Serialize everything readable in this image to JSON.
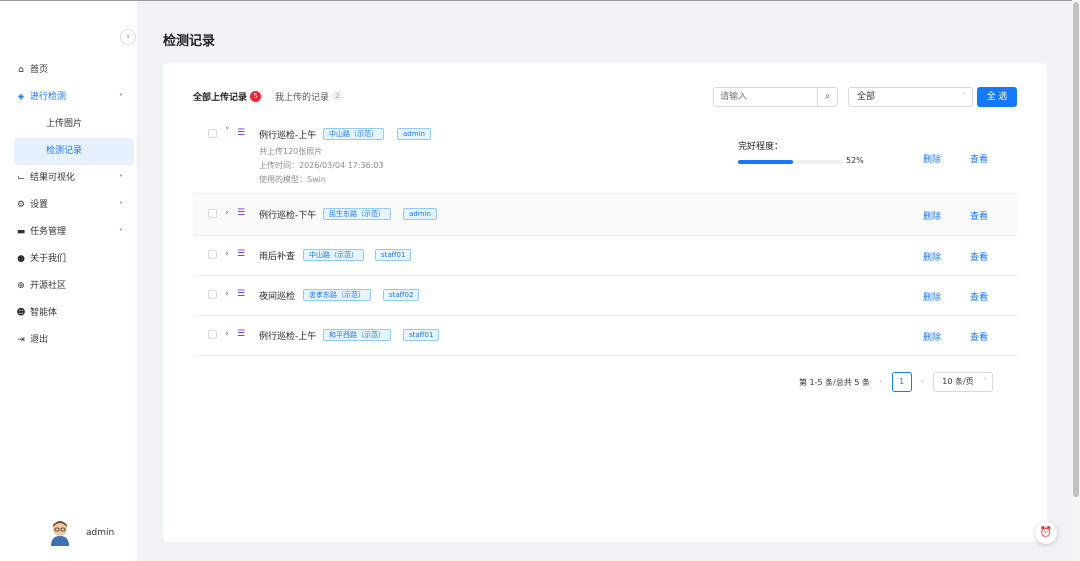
{
  "sidebar": {
    "collapse_icon": "chevron-left-icon",
    "items": [
      {
        "label": "首页",
        "icon": "home-icon"
      },
      {
        "label": "进行检测",
        "icon": "cube-icon",
        "expanded": true
      },
      {
        "label": "结果可视化",
        "icon": "line-chart-icon"
      },
      {
        "label": "设置",
        "icon": "gears-icon"
      },
      {
        "label": "任务管理",
        "icon": "server-icon"
      },
      {
        "label": "关于我们",
        "icon": "info-icon"
      },
      {
        "label": "开源社区",
        "icon": "globe-icon"
      },
      {
        "label": "智能体",
        "icon": "robot-icon"
      },
      {
        "label": "退出",
        "icon": "logout-icon"
      }
    ],
    "sub_items": [
      {
        "label": "上传图片"
      },
      {
        "label": "检测记录",
        "selected": true
      }
    ],
    "user": {
      "name": "admin"
    }
  },
  "page": {
    "title": "检测记录"
  },
  "tabs": [
    {
      "label": "全部上传记录",
      "count": "5"
    },
    {
      "label": "我上传的记录",
      "count": "2"
    }
  ],
  "search": {
    "placeholder": "请输入"
  },
  "filter": {
    "value": "全部"
  },
  "select_all_label": "全 选",
  "records": [
    {
      "name": "例行巡检-上午",
      "location": "中山路（示范）",
      "user": "admin",
      "expanded": true,
      "uploaded": "共上传120张照片",
      "time": "上传时间：2026/03/04 17:36:03",
      "model": "使用的模型：Swin",
      "progress_label": "完好程度：",
      "progress": 52,
      "progress_text": "52%",
      "delete": "删除",
      "view": "查看"
    },
    {
      "name": "例行巡检-下午",
      "location": "民生东路（示范）",
      "user": "admin",
      "delete": "删除",
      "view": "查看"
    },
    {
      "name": "雨后补查",
      "location": "中山路（示范）",
      "user": "staff01",
      "delete": "删除",
      "view": "查看"
    },
    {
      "name": "夜间巡检",
      "location": "忠孝东路（示范）",
      "user": "staff02",
      "delete": "删除",
      "view": "查看"
    },
    {
      "name": "例行巡检-上午",
      "location": "和平西路（示范）",
      "user": "staff01",
      "delete": "删除",
      "view": "查看"
    }
  ],
  "pagination": {
    "summary": "第 1-5 条/总共 5 条",
    "page": "1",
    "page_size": "10 条/页"
  },
  "colors": {
    "primary": "#1677ff",
    "danger": "#f5222d",
    "purple": "#722ed1"
  }
}
